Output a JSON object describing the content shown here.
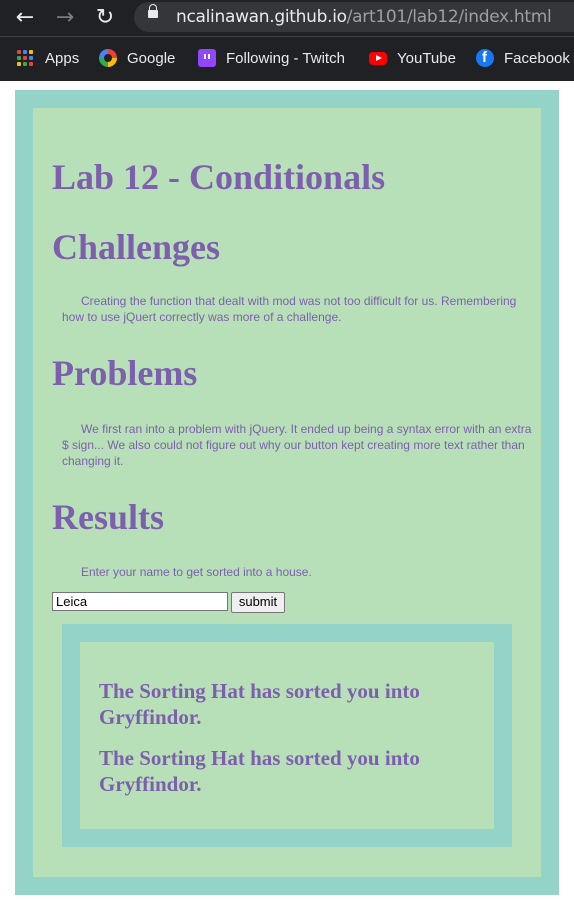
{
  "browser": {
    "url_host": "ncalinawan.github.io",
    "url_path": "/art101/lab12/index.html",
    "bookmarks": [
      {
        "label": "Apps",
        "icon": "apps-icon"
      },
      {
        "label": "Google",
        "icon": "google-icon"
      },
      {
        "label": "Following - Twitch",
        "icon": "twitch-icon"
      },
      {
        "label": "YouTube",
        "icon": "youtube-icon"
      },
      {
        "label": "Facebook",
        "icon": "facebook-icon"
      }
    ]
  },
  "page": {
    "title": "Lab 12 - Conditionals",
    "challenges_heading": "Challenges",
    "challenges_text": "Creating the function that dealt with mod was not too difficult for us. Remembering how to use jQuert correctly was more of a challenge.",
    "problems_heading": "Problems",
    "problems_text": "We first ran into a problem with jQuery. It ended up being a syntax error with an extra $ sign... We also could not figure out why our button kept creating more text rather than changing it.",
    "results_heading": "Results",
    "results_prompt": "Enter your name to get sorted into a house.",
    "name_value": "Leica",
    "submit_label": "submit",
    "output_messages": [
      "The Sorting Hat has sorted you into Gryffindor.",
      "The Sorting Hat has sorted you into Gryffindor."
    ]
  },
  "colors": {
    "outer_border": "#93d3c8",
    "inner_background": "#b8e0b8",
    "text": "#7d5fae"
  }
}
